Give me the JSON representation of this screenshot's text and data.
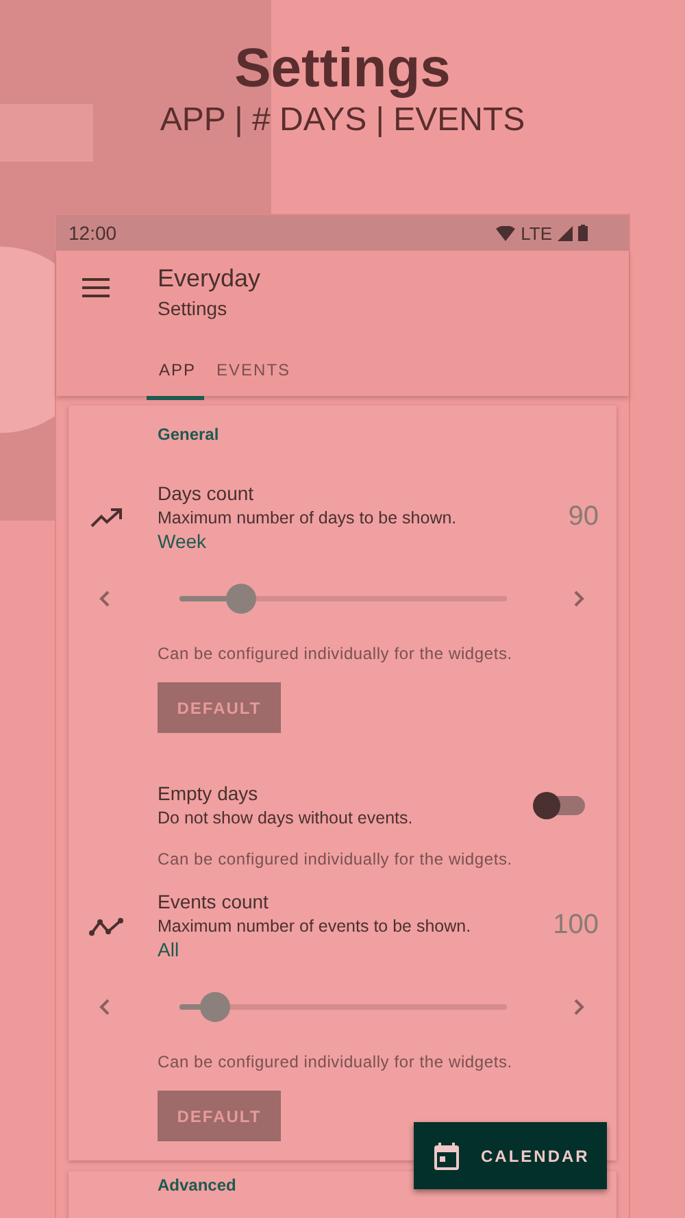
{
  "promo": {
    "title": "Settings",
    "subtitle": "APP | # DAYS | EVENTS"
  },
  "status_bar": {
    "time": "12:00",
    "network": "LTE"
  },
  "app_bar": {
    "title": "Everyday",
    "subtitle": "Settings"
  },
  "tabs": [
    {
      "label": "APP",
      "selected": true
    },
    {
      "label": "EVENTS",
      "selected": false
    }
  ],
  "sections": [
    {
      "header": "General",
      "items": [
        {
          "kind": "slider",
          "title": "Days count",
          "summary": "Maximum number of days to be shown.",
          "value_label": "Week",
          "reading": "90",
          "level": 0.19,
          "note": "Can be configured individually for the widgets.",
          "button": "DEFAULT"
        },
        {
          "kind": "switch",
          "title": "Empty days",
          "summary": "Do not show days without events.",
          "checked": false,
          "note": "Can be configured individually for the widgets."
        },
        {
          "kind": "slider",
          "title": "Events count",
          "summary": "Maximum number of events to be shown.",
          "value_label": "All",
          "reading": "100",
          "level": 0.11,
          "note": "Can be configured individually for the widgets.",
          "button": "DEFAULT"
        }
      ]
    },
    {
      "header": "Advanced"
    }
  ],
  "fab": {
    "label": "CALENDAR"
  }
}
